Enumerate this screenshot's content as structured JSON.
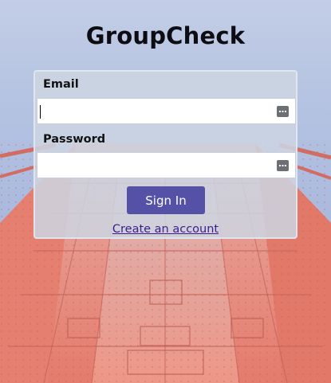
{
  "app": {
    "title": "GroupCheck"
  },
  "form": {
    "email_label": "Email",
    "email_value": "",
    "password_label": "Password",
    "password_value": "",
    "signin_label": "Sign In",
    "create_account_label": "Create an account"
  },
  "colors": {
    "button": "#5451a6",
    "link": "#3d1d8a",
    "bridge": "#e6877a"
  },
  "icons": [
    "password-manager-icon"
  ]
}
